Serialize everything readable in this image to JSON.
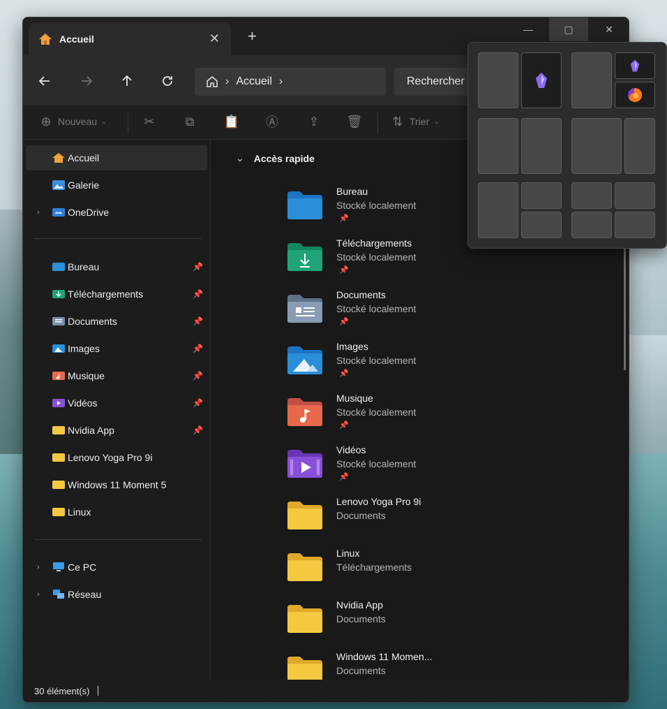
{
  "window": {
    "tab_title": "Accueil",
    "new_tab_label": "+",
    "close_tab_label": "✕",
    "controls": {
      "minimize": "—",
      "maximize": "▢",
      "close": "✕"
    }
  },
  "address": {
    "crumbs": [
      "Accueil"
    ],
    "search_placeholder": "Rechercher"
  },
  "commands": {
    "new_label": "Nouveau",
    "sort_label": "Trier"
  },
  "sidebar": {
    "items": [
      {
        "label": "Accueil",
        "icon": "home-icon",
        "pinned": false,
        "expandable": false,
        "selected": true
      },
      {
        "label": "Galerie",
        "icon": "gallery-icon",
        "pinned": false,
        "expandable": false
      },
      {
        "label": "OneDrive",
        "icon": "onedrive-icon",
        "pinned": false,
        "expandable": true
      },
      {
        "label": "Bureau",
        "icon": "desktop-folder-icon",
        "pinned": true
      },
      {
        "label": "Téléchargements",
        "icon": "downloads-folder-icon",
        "pinned": true
      },
      {
        "label": "Documents",
        "icon": "documents-folder-icon",
        "pinned": true
      },
      {
        "label": "Images",
        "icon": "pictures-folder-icon",
        "pinned": true
      },
      {
        "label": "Musique",
        "icon": "music-folder-icon",
        "pinned": true
      },
      {
        "label": "Vidéos",
        "icon": "videos-folder-icon",
        "pinned": true
      },
      {
        "label": "Nvidia App",
        "icon": "folder-icon",
        "pinned": true
      },
      {
        "label": "Lenovo Yoga Pro 9i",
        "icon": "folder-icon",
        "pinned": false
      },
      {
        "label": "Windows 11 Moment 5",
        "icon": "folder-icon",
        "pinned": false
      },
      {
        "label": "Linux",
        "icon": "folder-icon",
        "pinned": false
      },
      {
        "label": "Ce PC",
        "icon": "this-pc-icon",
        "expandable": true
      },
      {
        "label": "Réseau",
        "icon": "network-icon",
        "expandable": true
      }
    ]
  },
  "quick_access": {
    "title": "Accès rapide",
    "items": [
      {
        "name": "Bureau",
        "sub": "Stocké localement",
        "pinned": true,
        "icon": "desktop-folder-icon"
      },
      {
        "name": "Téléchargements",
        "sub": "Stocké localement",
        "pinned": true,
        "icon": "downloads-folder-icon"
      },
      {
        "name": "Documents",
        "sub": "Stocké localement",
        "pinned": true,
        "icon": "documents-folder-icon"
      },
      {
        "name": "Images",
        "sub": "Stocké localement",
        "pinned": true,
        "icon": "pictures-folder-icon"
      },
      {
        "name": "Musique",
        "sub": "Stocké localement",
        "pinned": true,
        "icon": "music-folder-icon"
      },
      {
        "name": "Vidéos",
        "sub": "Stocké localement",
        "pinned": true,
        "icon": "videos-folder-icon"
      },
      {
        "name": "Lenovo Yoga Pro 9i",
        "sub": "Documents",
        "pinned": false,
        "icon": "folder-icon"
      },
      {
        "name": "Linux",
        "sub": "Téléchargements",
        "pinned": false,
        "icon": "folder-icon"
      },
      {
        "name": "Nvidia App",
        "sub": "Documents",
        "pinned": false,
        "icon": "folder-icon"
      },
      {
        "name": "Windows 11 Momen...",
        "sub": "Documents",
        "pinned": false,
        "icon": "folder-icon"
      }
    ]
  },
  "status": {
    "count": "30 élément(s)"
  },
  "colors": {
    "window_bg": "#1c1c1c",
    "folder_yellow": "#f5c842",
    "desktop_blue": "#2a8fd8",
    "downloads_green": "#1fa37a",
    "music_orange": "#e8684a",
    "videos_purple": "#8a4fd8"
  }
}
